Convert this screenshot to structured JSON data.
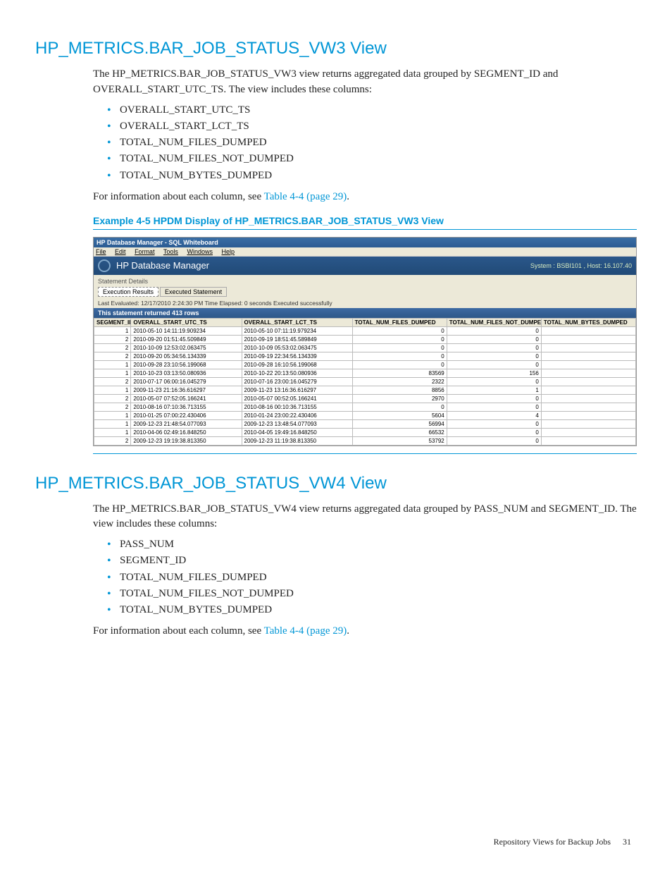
{
  "section_vw3": {
    "title": "HP_METRICS.BAR_JOB_STATUS_VW3 View",
    "intro": "The HP_METRICS.BAR_JOB_STATUS_VW3 view returns aggregated data grouped by SEGMENT_ID and OVERALL_START_UTC_TS. The view includes these columns:",
    "columns": [
      "OVERALL_START_UTC_TS",
      "OVERALL_START_LCT_TS",
      "TOTAL_NUM_FILES_DUMPED",
      "TOTAL_NUM_FILES_NOT_DUMPED",
      "TOTAL_NUM_BYTES_DUMPED"
    ],
    "info_prefix": "For information about each column, see ",
    "info_link": "Table 4-4 (page 29)",
    "info_suffix": ".",
    "example_heading": "Example 4-5 HPDM Display of HP_METRICS.BAR_JOB_STATUS_VW3 View"
  },
  "screenshot": {
    "window_title": "HP Database Manager - SQL Whiteboard",
    "menubar": [
      "File",
      "Edit",
      "Format",
      "Tools",
      "Windows",
      "Help"
    ],
    "brand_title": "HP Database Manager",
    "brand_right": "System : BSBI101 , Host: 16.107.40",
    "detail_label": "Statement Details",
    "tab_active": "Execution Results",
    "tab_inactive": "Executed Statement",
    "status_line": "Last Evaluated: 12/17/2010 2:24:30 PM    Time Elapsed: 0 seconds     Executed successfully",
    "returned_line": "This statement returned 413 rows",
    "headers": [
      "SEGMENT_ID",
      "OVERALL_START_UTC_TS",
      "OVERALL_START_LCT_TS",
      "TOTAL_NUM_FILES_DUMPED",
      "TOTAL_NUM_FILES_NOT_DUMPED",
      "TOTAL_NUM_BYTES_DUMPED"
    ],
    "rows": [
      [
        "1",
        "2010-05-10 14:11:19.909234",
        "2010-05-10 07:11:19.979234",
        "0",
        "0",
        ""
      ],
      [
        "2",
        "2010-09-20 01:51:45.509849",
        "2010-09-19 18:51:45.589849",
        "0",
        "0",
        ""
      ],
      [
        "2",
        "2010-10-09 12:53:02.063475",
        "2010-10-09 05:53:02.063475",
        "0",
        "0",
        ""
      ],
      [
        "2",
        "2010-09-20 05:34:56.134339",
        "2010-09-19 22:34:56.134339",
        "0",
        "0",
        ""
      ],
      [
        "1",
        "2010-09-28 23:10:56.199068",
        "2010-09-28 16:10:56.199068",
        "0",
        "0",
        ""
      ],
      [
        "1",
        "2010-10-23 03:13:50.080936",
        "2010-10-22 20:13:50.080936",
        "83569",
        "156",
        ""
      ],
      [
        "2",
        "2010-07-17 06:00:16.045279",
        "2010-07-16 23:00:16.045279",
        "2322",
        "0",
        ""
      ],
      [
        "1",
        "2009-11-23 21:16:36.616297",
        "2009-11-23 13:16:36.616297",
        "8856",
        "1",
        ""
      ],
      [
        "2",
        "2010-05-07 07:52:05.166241",
        "2010-05-07 00:52:05.166241",
        "2970",
        "0",
        ""
      ],
      [
        "2",
        "2010-08-16 07:10:36.713155",
        "2010-08-16 00:10:36.713155",
        "0",
        "0",
        ""
      ],
      [
        "1",
        "2010-01-25 07:00:22.430406",
        "2010-01-24 23:00:22.430406",
        "5604",
        "4",
        ""
      ],
      [
        "1",
        "2009-12-23 21:48:54.077093",
        "2009-12-23 13:48:54.077093",
        "56994",
        "0",
        ""
      ],
      [
        "1",
        "2010-04-06 02:49:16.848250",
        "2010-04-05 19:49:16.848250",
        "66532",
        "0",
        ""
      ],
      [
        "2",
        "2009-12-23 19:19:38.813350",
        "2009-12-23 11:19:38.813350",
        "53792",
        "0",
        ""
      ]
    ]
  },
  "section_vw4": {
    "title": "HP_METRICS.BAR_JOB_STATUS_VW4 View",
    "intro": "The HP_METRICS.BAR_JOB_STATUS_VW4 view returns aggregated data grouped by PASS_NUM and SEGMENT_ID. The view includes these columns:",
    "columns": [
      "PASS_NUM",
      "SEGMENT_ID",
      "TOTAL_NUM_FILES_DUMPED",
      "TOTAL_NUM_FILES_NOT_DUMPED",
      "TOTAL_NUM_BYTES_DUMPED"
    ],
    "info_prefix": "For information about each column, see ",
    "info_link": "Table 4-4 (page 29)",
    "info_suffix": "."
  },
  "footer": {
    "label": "Repository Views for Backup Jobs",
    "page": "31"
  }
}
